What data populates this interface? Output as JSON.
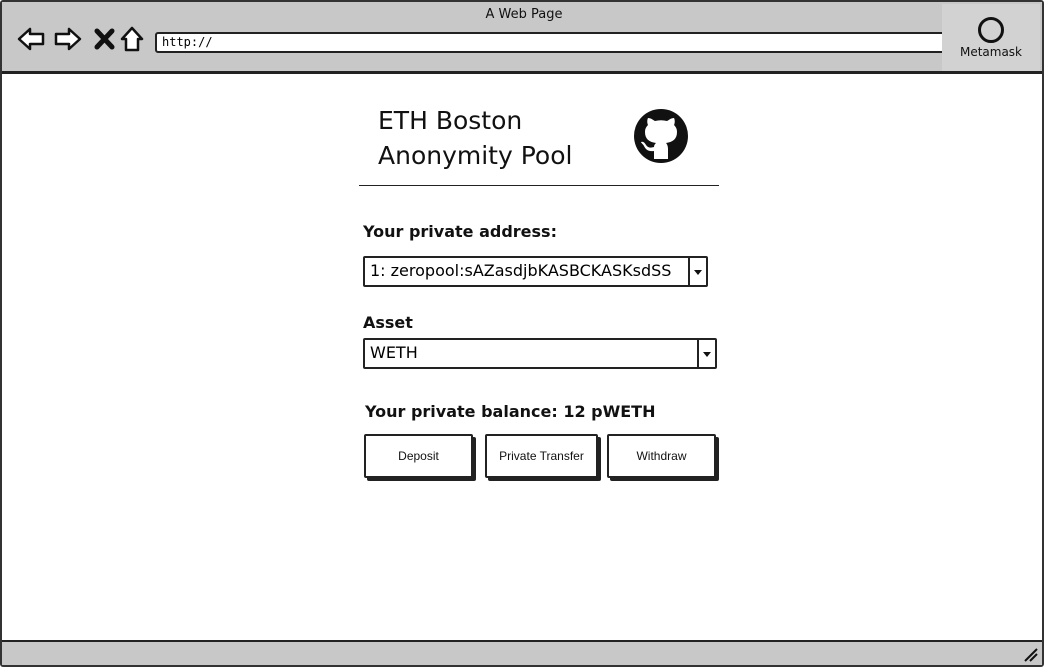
{
  "browser": {
    "title": "A Web Page",
    "url": "http://",
    "extension_label": "Metamask",
    "icons": [
      "back-arrow-icon",
      "forward-arrow-icon",
      "close-icon",
      "home-icon"
    ]
  },
  "header": {
    "title_line1": "ETH Boston",
    "title_line2": "Anonymity Pool",
    "logo_icon": "github-icon"
  },
  "form": {
    "private_address_label": "Your private address:",
    "private_address_value": "1: zeropool:sAZasdjbKASBCKASKsdSS",
    "asset_label": "Asset",
    "asset_value": "WETH",
    "balance_text": "Your private balance: 12 pWETH"
  },
  "actions": {
    "deposit": "Deposit",
    "private_transfer": "Private Transfer",
    "withdraw": "Withdraw"
  }
}
